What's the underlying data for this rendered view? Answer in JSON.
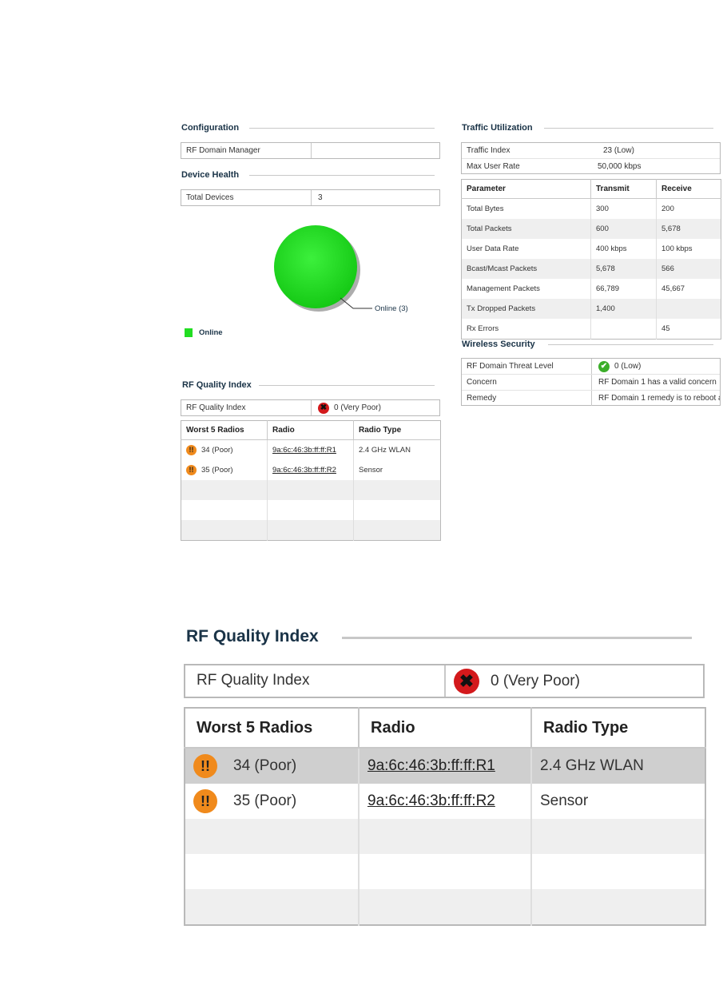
{
  "configuration": {
    "title": "Configuration",
    "rf_domain_manager_label": "RF Domain Manager",
    "rf_domain_manager_value": ""
  },
  "device_health": {
    "title": "Device Health",
    "total_devices_label": "Total Devices",
    "total_devices_value": "3",
    "pie_label": "Online (3)",
    "legend_online": "Online",
    "online_color": "#22dd22"
  },
  "chart_data": {
    "type": "pie",
    "categories": [
      "Online"
    ],
    "values": [
      3
    ],
    "annotations": [
      "Online (3)"
    ],
    "legend": [
      "Online"
    ],
    "colors": [
      "#22dd22"
    ]
  },
  "rf_quality": {
    "title": "RF Quality Index",
    "index_label": "RF Quality Index",
    "index_value": "0 (Very Poor)",
    "headers": [
      "Worst 5 Radios",
      "Radio",
      "Radio Type"
    ],
    "rows": [
      {
        "score": "34 (Poor)",
        "radio": "9a:6c:46:3b:ff:ff:R1",
        "type": "2.4 GHz WLAN"
      },
      {
        "score": "35 (Poor)",
        "radio": "9a:6c:46:3b:ff:ff:R2",
        "type": "Sensor"
      }
    ]
  },
  "traffic": {
    "title": "Traffic Utilization",
    "traffic_index_label": "Traffic Index",
    "traffic_index_value": "23 (Low)",
    "max_user_rate_label": "Max User Rate",
    "max_user_rate_value": "50,000 kbps",
    "headers": [
      "Parameter",
      "Transmit",
      "Receive"
    ],
    "rows": [
      {
        "param": "Total Bytes",
        "tx": "300",
        "rx": "200"
      },
      {
        "param": "Total Packets",
        "tx": "600",
        "rx": "5,678"
      },
      {
        "param": "User Data Rate",
        "tx": "400 kbps",
        "rx": "100 kbps"
      },
      {
        "param": "Bcast/Mcast Packets",
        "tx": "5,678",
        "rx": "566"
      },
      {
        "param": "Management Packets",
        "tx": "66,789",
        "rx": "45,667"
      },
      {
        "param": "Tx Dropped Packets",
        "tx": "1,400",
        "rx": ""
      },
      {
        "param": "Rx Errors",
        "tx": "",
        "rx": "45"
      }
    ]
  },
  "wireless_security": {
    "title": "Wireless Security",
    "threat_label": "RF Domain Threat Level",
    "threat_value": "0 (Low)",
    "concern_label": "Concern",
    "concern_value": "RF Domain 1 has a valid concern",
    "remedy_label": "Remedy",
    "remedy_value": "RF Domain 1 remedy is to reboot a"
  },
  "icons": {
    "poor": "!!",
    "very_poor": "✖",
    "ok": "✔"
  }
}
